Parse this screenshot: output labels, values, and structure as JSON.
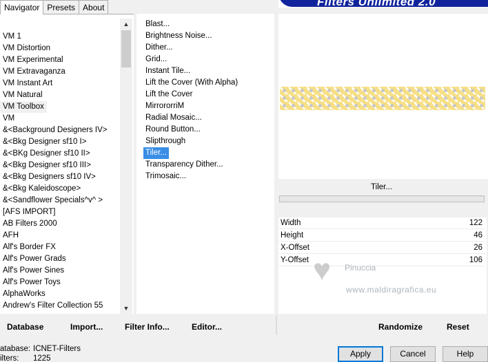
{
  "tabs": [
    {
      "label": "Navigator",
      "active": true
    },
    {
      "label": "Presets",
      "active": false
    },
    {
      "label": "About",
      "active": false
    }
  ],
  "banner": {
    "title": "Filters Unlimited 2.0",
    "color": "#11239c"
  },
  "categories": [
    "VM 1",
    "VM Distortion",
    "VM Experimental",
    "VM Extravaganza",
    "VM Instant Art",
    "VM Natural",
    "VM Toolbox",
    "VM",
    "&<Background Designers IV>",
    "&<Bkg Designer sf10 I>",
    "&<BKg Designer sf10 II>",
    "&<Bkg Designer sf10 III>",
    "&<Bkg Designers sf10 IV>",
    "&<Bkg Kaleidoscope>",
    "&<Sandflower Specials^v^ >",
    "[AFS IMPORT]",
    "AB Filters 2000",
    "AFH",
    "Alf's Border FX",
    "Alf's Power Grads",
    "Alf's Power Sines",
    "Alf's Power Toys",
    "AlphaWorks",
    "Andrew's Filter Collection 55"
  ],
  "selected_category": "VM Toolbox",
  "filters": [
    "Blast...",
    "Brightness Noise...",
    "Dither...",
    "Grid...",
    "Instant Tile...",
    "Lift the Cover (With Alpha)",
    "Lift the Cover",
    "MirrororriM",
    "Radial Mosaic...",
    "Round Button...",
    "Slipthrough",
    "Tiler...",
    "Transparency Dither...",
    "Trimosaic..."
  ],
  "selected_filter": "Tiler...",
  "filter_title": "Tiler...",
  "params": [
    {
      "name": "Width",
      "value": "122"
    },
    {
      "name": "Height",
      "value": "46"
    },
    {
      "name": "X-Offset",
      "value": "26"
    },
    {
      "name": "Y-Offset",
      "value": "106"
    }
  ],
  "watermark": {
    "name": "Pinuccia",
    "site": "www.maldiragrafica.eu"
  },
  "toolbar": {
    "database": "Database",
    "import": "Import...",
    "filter_info": "Filter Info...",
    "editor": "Editor...",
    "randomize": "Randomize",
    "reset": "Reset"
  },
  "status": {
    "database_label": "atabase:",
    "database_value": "ICNET-Filters",
    "filters_label": "ilters:",
    "filters_value": "1225"
  },
  "dialog": {
    "apply": "Apply",
    "cancel": "Cancel",
    "help": "Help"
  },
  "colors": {
    "selection": "#3a8ee6",
    "tile_yellow": "#f6df86",
    "default_button_border": "#0078d7"
  }
}
